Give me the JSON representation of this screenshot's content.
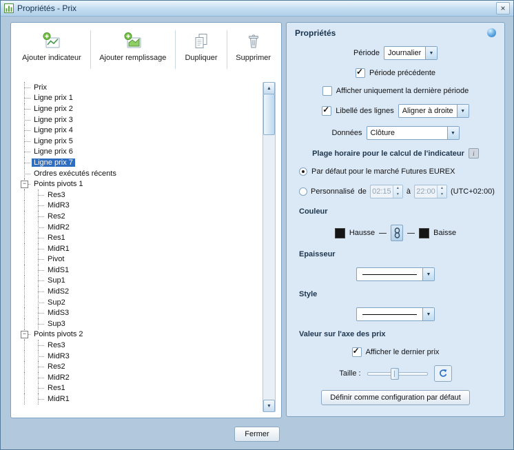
{
  "window": {
    "title": "Propriétés - Prix",
    "close_glyph": "×"
  },
  "toolbar": {
    "buttons": [
      {
        "label": "Ajouter indicateur"
      },
      {
        "label": "Ajouter remplissage"
      },
      {
        "label": "Dupliquer"
      },
      {
        "label": "Supprimer"
      }
    ]
  },
  "tree": {
    "collapse_glyph": "−",
    "items": [
      {
        "label": "Prix",
        "level": 0,
        "type": "leaf"
      },
      {
        "label": "Ligne prix 1",
        "level": 0,
        "type": "leaf"
      },
      {
        "label": "Ligne prix 2",
        "level": 0,
        "type": "leaf"
      },
      {
        "label": "Ligne prix 3",
        "level": 0,
        "type": "leaf"
      },
      {
        "label": "Ligne prix 4",
        "level": 0,
        "type": "leaf"
      },
      {
        "label": "Ligne prix 5",
        "level": 0,
        "type": "leaf"
      },
      {
        "label": "Ligne prix 6",
        "level": 0,
        "type": "leaf"
      },
      {
        "label": "Ligne prix 7",
        "level": 0,
        "type": "leaf",
        "selected": true
      },
      {
        "label": "Ordres exécutés récents",
        "level": 0,
        "type": "leaf"
      },
      {
        "label": "Points pivots 1",
        "level": 0,
        "type": "branch",
        "expanded": true
      },
      {
        "label": "Res3",
        "level": 1,
        "type": "leaf"
      },
      {
        "label": "MidR3",
        "level": 1,
        "type": "leaf"
      },
      {
        "label": "Res2",
        "level": 1,
        "type": "leaf"
      },
      {
        "label": "MidR2",
        "level": 1,
        "type": "leaf"
      },
      {
        "label": "Res1",
        "level": 1,
        "type": "leaf"
      },
      {
        "label": "MidR1",
        "level": 1,
        "type": "leaf"
      },
      {
        "label": "Pivot",
        "level": 1,
        "type": "leaf"
      },
      {
        "label": "MidS1",
        "level": 1,
        "type": "leaf"
      },
      {
        "label": "Sup1",
        "level": 1,
        "type": "leaf"
      },
      {
        "label": "MidS2",
        "level": 1,
        "type": "leaf"
      },
      {
        "label": "Sup2",
        "level": 1,
        "type": "leaf"
      },
      {
        "label": "MidS3",
        "level": 1,
        "type": "leaf"
      },
      {
        "label": "Sup3",
        "level": 1,
        "type": "leaf"
      },
      {
        "label": "Points pivots 2",
        "level": 0,
        "type": "branch",
        "expanded": true
      },
      {
        "label": "Res3",
        "level": 1,
        "type": "leaf"
      },
      {
        "label": "MidR3",
        "level": 1,
        "type": "leaf"
      },
      {
        "label": "Res2",
        "level": 1,
        "type": "leaf"
      },
      {
        "label": "MidR2",
        "level": 1,
        "type": "leaf"
      },
      {
        "label": "Res1",
        "level": 1,
        "type": "leaf"
      },
      {
        "label": "MidR1",
        "level": 1,
        "type": "leaf"
      }
    ]
  },
  "props": {
    "title": "Propriétés",
    "periode": {
      "label": "Période",
      "value": "Journalier"
    },
    "periode_precedente": {
      "label": "Période précédente",
      "checked": true
    },
    "afficher_derniere": {
      "label": "Afficher uniquement la dernière période",
      "checked": false
    },
    "libelle": {
      "label": "Libellé des lignes",
      "checked": true,
      "value": "Aligner à droite"
    },
    "donnees": {
      "label": "Données",
      "value": "Clôture"
    },
    "plage": {
      "title": "Plage horaire pour le calcul de l'indicateur",
      "info_glyph": "i",
      "default_option": {
        "label": "Par défaut pour le marché Futures EUREX",
        "selected": true
      },
      "custom_option": {
        "label": "Personnalisé",
        "selected": false,
        "de": "de",
        "a": "à",
        "from": "02:15",
        "to": "22:00",
        "utc": "(UTC+02:00)"
      }
    },
    "couleur": {
      "label": "Couleur",
      "hausse": "Hausse",
      "baisse": "Baisse",
      "hausse_color": "#151515",
      "baisse_color": "#151515"
    },
    "epaisseur": {
      "label": "Epaisseur"
    },
    "style": {
      "label": "Style"
    },
    "valeur_axe": {
      "label": "Valeur sur l'axe des prix"
    },
    "dernier_prix": {
      "label": "Afficher le dernier prix",
      "checked": true
    },
    "taille": {
      "label": "Taille :"
    },
    "define_default": "Définir comme configuration par défaut"
  },
  "footer": {
    "close_label": "Fermer"
  }
}
